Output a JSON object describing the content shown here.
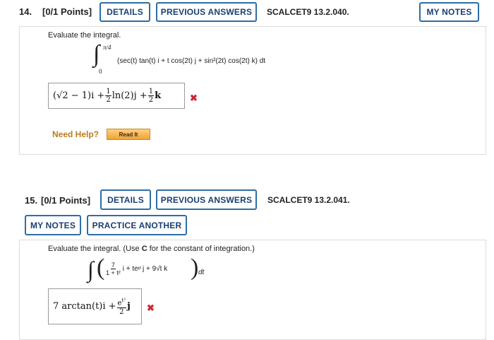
{
  "q14": {
    "number": "14.",
    "points": "[0/1 Points]",
    "details_label": "DETAILS",
    "previous_label": "PREVIOUS ANSWERS",
    "ref": "SCALCET9 13.2.040.",
    "my_notes_label": "MY NOTES",
    "prompt": "Evaluate the integral.",
    "upper_limit": "π/4",
    "lower_limit": "0",
    "integrand": "(sec(t) tan(t) i + t cos(2t) j + sin²(2t) cos(2t) k) dt",
    "answer_a": "(√2 − 1)i +",
    "answer_frac1_num": "1",
    "answer_frac1_den": "2",
    "answer_b": "ln(2)j +",
    "answer_frac2_num": "1",
    "answer_frac2_den": "2",
    "answer_c": "k",
    "status_icon": "x-mark-icon",
    "need_help": "Need Help?",
    "read_it": "Read It"
  },
  "q15": {
    "number": "15.",
    "points": "[0/1 Points]",
    "details_label": "DETAILS",
    "previous_label": "PREVIOUS ANSWERS",
    "ref": "SCALCET9 13.2.041.",
    "my_notes_label": "MY NOTES",
    "practice_label": "PRACTICE ANOTHER",
    "prompt_a": "Evaluate the integral. (Use ",
    "prompt_bold": "C",
    "prompt_b": " for the constant of integration.)",
    "frac_num": "7",
    "frac_den": "1 + t²",
    "integrand_rest": "i + te",
    "exp": "t²",
    "integrand_tail": "j + 9√t k",
    "dt": "dt",
    "answer_a": "7 arctan(t)i +",
    "answer_frac_num": "e",
    "answer_frac_num_exp": "t²",
    "answer_frac_den": "2",
    "answer_b": "j",
    "status_icon": "x-mark-icon"
  },
  "colors": {
    "button_border": "#2e6da4",
    "button_text": "#1a3f73",
    "wrong": "#cc2936",
    "help": "#b87d1c"
  }
}
